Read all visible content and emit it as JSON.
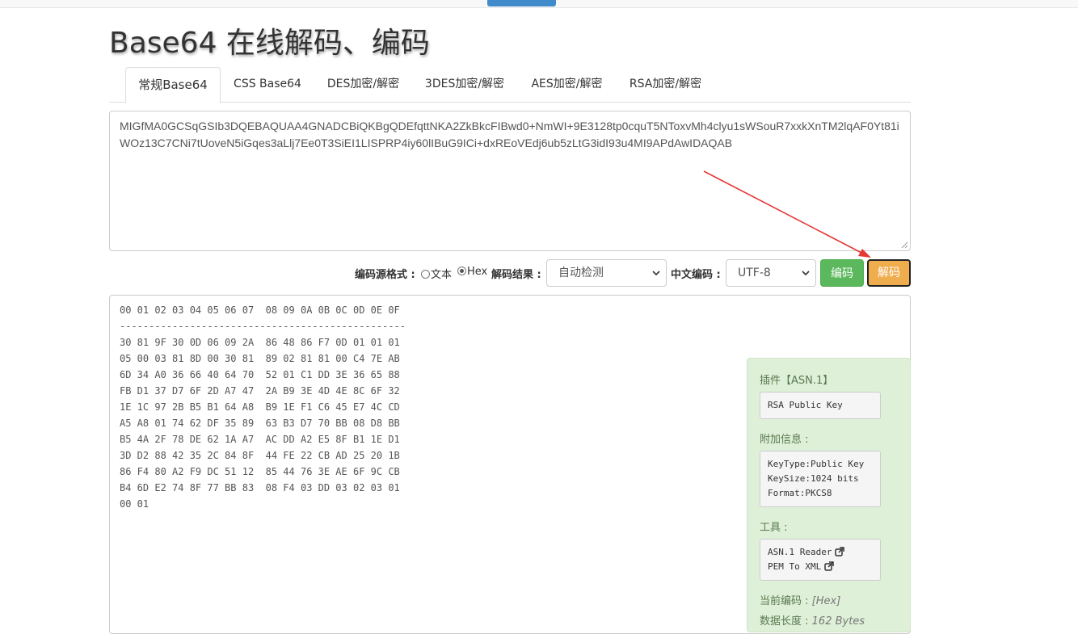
{
  "page": {
    "title": "Base64 在线解码、编码"
  },
  "tabs": [
    {
      "label": "常规Base64",
      "active": true
    },
    {
      "label": "CSS Base64",
      "active": false
    },
    {
      "label": "DES加密/解密",
      "active": false
    },
    {
      "label": "3DES加密/解密",
      "active": false
    },
    {
      "label": "AES加密/解密",
      "active": false
    },
    {
      "label": "RSA加密/解密",
      "active": false
    }
  ],
  "input": {
    "value": "MIGfMA0GCSqGSIb3DQEBAQUAA4GNADCBiQKBgQDEfqttNKA2ZkBkcFIBwd0+NmWI+9E3128tp0cquT5NToxvMh4clyu1sWSouR7xxkXnTM2lqAF0Yt81iWOz13C7CNi7tUoveN5iGqes3aLlj7Ee0T3SiEI1LISPRP4iy60lIBuG9ICi+dxREoVEdj6ub5zLtG3idI93u4MI9APdAwIDAQAB"
  },
  "controls": {
    "source_format_label": "编码源格式 :",
    "radio_text_label": "文本",
    "radio_hex_label": "Hex",
    "selected_format": "Hex",
    "result_label": "解码结果 :",
    "result_select_value": "自动检测",
    "charset_label": "中文编码 :",
    "charset_select_value": "UTF-8",
    "encode_button": "编码",
    "decode_button": "解码"
  },
  "colors": {
    "encode_button": "#5cb85c",
    "decode_button": "#f0ad4e",
    "annotation_arrow": "#e53935",
    "plugin_panel_bg": "#dff0d8"
  },
  "output": {
    "hex_dump": "00 01 02 03 04 05 06 07  08 09 0A 0B 0C 0D 0E 0F\n-------------------------------------------------\n30 81 9F 30 0D 06 09 2A  86 48 86 F7 0D 01 01 01\n05 00 03 81 8D 00 30 81  89 02 81 81 00 C4 7E AB\n6D 34 A0 36 66 40 64 70  52 01 C1 DD 3E 36 65 88\nFB D1 37 D7 6F 2D A7 47  2A B9 3E 4D 4E 8C 6F 32\n1E 1C 97 2B B5 B1 64 A8  B9 1E F1 C6 45 E7 4C CD\nA5 A8 01 74 62 DF 35 89  63 B3 D7 70 BB 08 D8 BB\nB5 4A 2F 78 DE 62 1A A7  AC DD A2 E5 8F B1 1E D1\n3D D2 88 42 35 2C 84 8F  44 FE 22 CB AD 25 20 1B\n86 F4 80 A2 F9 DC 51 12  85 44 76 3E AE 6F 9C CB\nB4 6D E2 74 8F 77 BB 83  08 F4 03 DD 03 02 03 01\n00 01"
  },
  "plugin": {
    "plugin_label": "插件【ASN.1】",
    "plugin_value": "RSA Public Key",
    "extra_label": "附加信息 :",
    "extra_lines": [
      "KeyType:Public Key",
      "KeySize:1024 bits",
      "Format:PKCS8"
    ],
    "tools_label": "工具 :",
    "tools": [
      "ASN.1 Reader",
      "PEM To XML"
    ],
    "current_encoding_label": "当前编码 :",
    "current_encoding_value": "[Hex]",
    "data_length_label": "数据长度 :",
    "data_length_value": "162 Bytes"
  }
}
